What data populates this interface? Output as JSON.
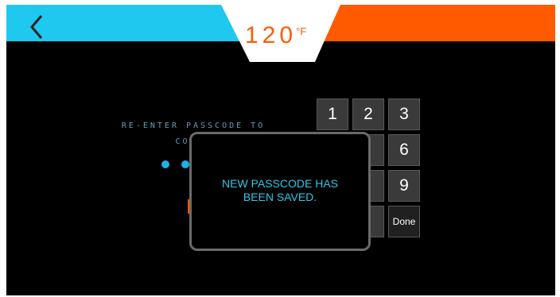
{
  "header": {
    "temperature": "120",
    "unit": "°F",
    "colors": {
      "left": "#1ec8ee",
      "right": "#ff5a00",
      "center": "#ffffff"
    }
  },
  "prompt": {
    "line1": "RE-ENTER PASSCODE TO",
    "line2": "CON"
  },
  "passcode_dots": 2,
  "keypad": {
    "keys": [
      "1",
      "2",
      "3",
      "6",
      "9",
      "Done"
    ]
  },
  "dialog": {
    "message": "NEW PASSCODE HAS\nBEEN SAVED."
  }
}
